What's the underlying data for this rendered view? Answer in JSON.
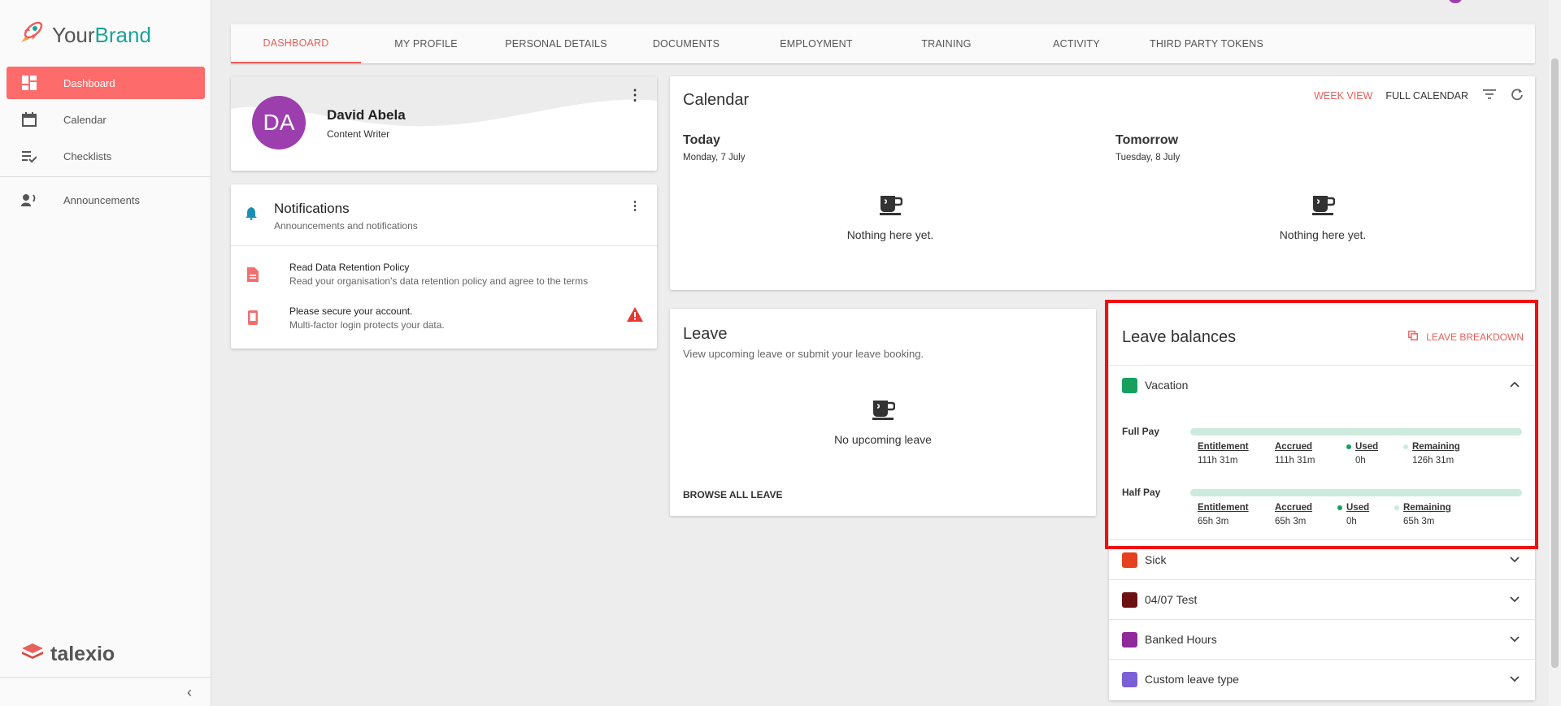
{
  "brand": {
    "part1": "Your",
    "part2": "Brand",
    "footer_logo": "talexio"
  },
  "sidebar": {
    "items": [
      {
        "label": "Dashboard",
        "icon": "dashboard-icon",
        "active": true
      },
      {
        "label": "Calendar",
        "icon": "calendar-icon",
        "active": false
      },
      {
        "label": "Checklists",
        "icon": "checklist-icon",
        "active": false
      },
      {
        "label": "Announcements",
        "icon": "announcement-icon",
        "active": false
      }
    ]
  },
  "tabs": [
    {
      "label": "DASHBOARD",
      "active": true
    },
    {
      "label": "MY PROFILE"
    },
    {
      "label": "PERSONAL DETAILS"
    },
    {
      "label": "DOCUMENTS"
    },
    {
      "label": "EMPLOYMENT"
    },
    {
      "label": "TRAINING"
    },
    {
      "label": "ACTIVITY"
    },
    {
      "label": "THIRD PARTY TOKENS"
    }
  ],
  "profile": {
    "initials": "DA",
    "name": "David Abela",
    "role": "Content Writer"
  },
  "notifications": {
    "title": "Notifications",
    "subtitle": "Announcements and notifications",
    "items": [
      {
        "title": "Read Data Retention Policy",
        "subtitle": "Read your organisation's data retention policy and agree to the terms",
        "icon": "document-icon"
      },
      {
        "title": "Please secure your account.",
        "subtitle": "Multi-factor login protects your data.",
        "icon": "phone-icon",
        "alert_icon": "warning-icon"
      }
    ]
  },
  "calendar": {
    "title": "Calendar",
    "week_view": "WEEK VIEW",
    "full_calendar": "FULL CALENDAR",
    "today": {
      "label": "Today",
      "date": "Monday, 7 July",
      "empty": "Nothing here yet."
    },
    "tomorrow": {
      "label": "Tomorrow",
      "date": "Tuesday, 8 July",
      "empty": "Nothing here yet."
    }
  },
  "leave": {
    "title": "Leave",
    "subtitle": "View upcoming leave or submit your leave booking.",
    "empty": "No upcoming leave",
    "browse": "BROWSE ALL LEAVE"
  },
  "balances": {
    "title": "Leave balances",
    "breakdown": "LEAVE BREAKDOWN",
    "vacation": {
      "name": "Vacation",
      "color": "#17a05d",
      "full_pay": {
        "label": "Full Pay",
        "entitlement_label": "Entitlement",
        "entitlement": "111h 31m",
        "accrued_label": "Accrued",
        "accrued": "111h 31m",
        "used_label": "Used",
        "used": "0h",
        "remaining_label": "Remaining",
        "remaining": "126h 31m"
      },
      "half_pay": {
        "label": "Half Pay",
        "entitlement_label": "Entitlement",
        "entitlement": "65h 3m",
        "accrued_label": "Accrued",
        "accrued": "65h 3m",
        "used_label": "Used",
        "used": "0h",
        "remaining_label": "Remaining",
        "remaining": "65h 3m"
      }
    },
    "types": [
      {
        "name": "Sick",
        "color": "#e5401f"
      },
      {
        "name": "04/07 Test",
        "color": "#6b1111"
      },
      {
        "name": "Banked Hours",
        "color": "#8e2a9a"
      },
      {
        "name": "Custom leave type",
        "color": "#7b5fd6"
      }
    ]
  },
  "colors": {
    "accent": "#fd6b6b",
    "accent_text": "#e8605a",
    "used_dot": "#17a05d",
    "remaining_dot": "#cdebdd"
  }
}
